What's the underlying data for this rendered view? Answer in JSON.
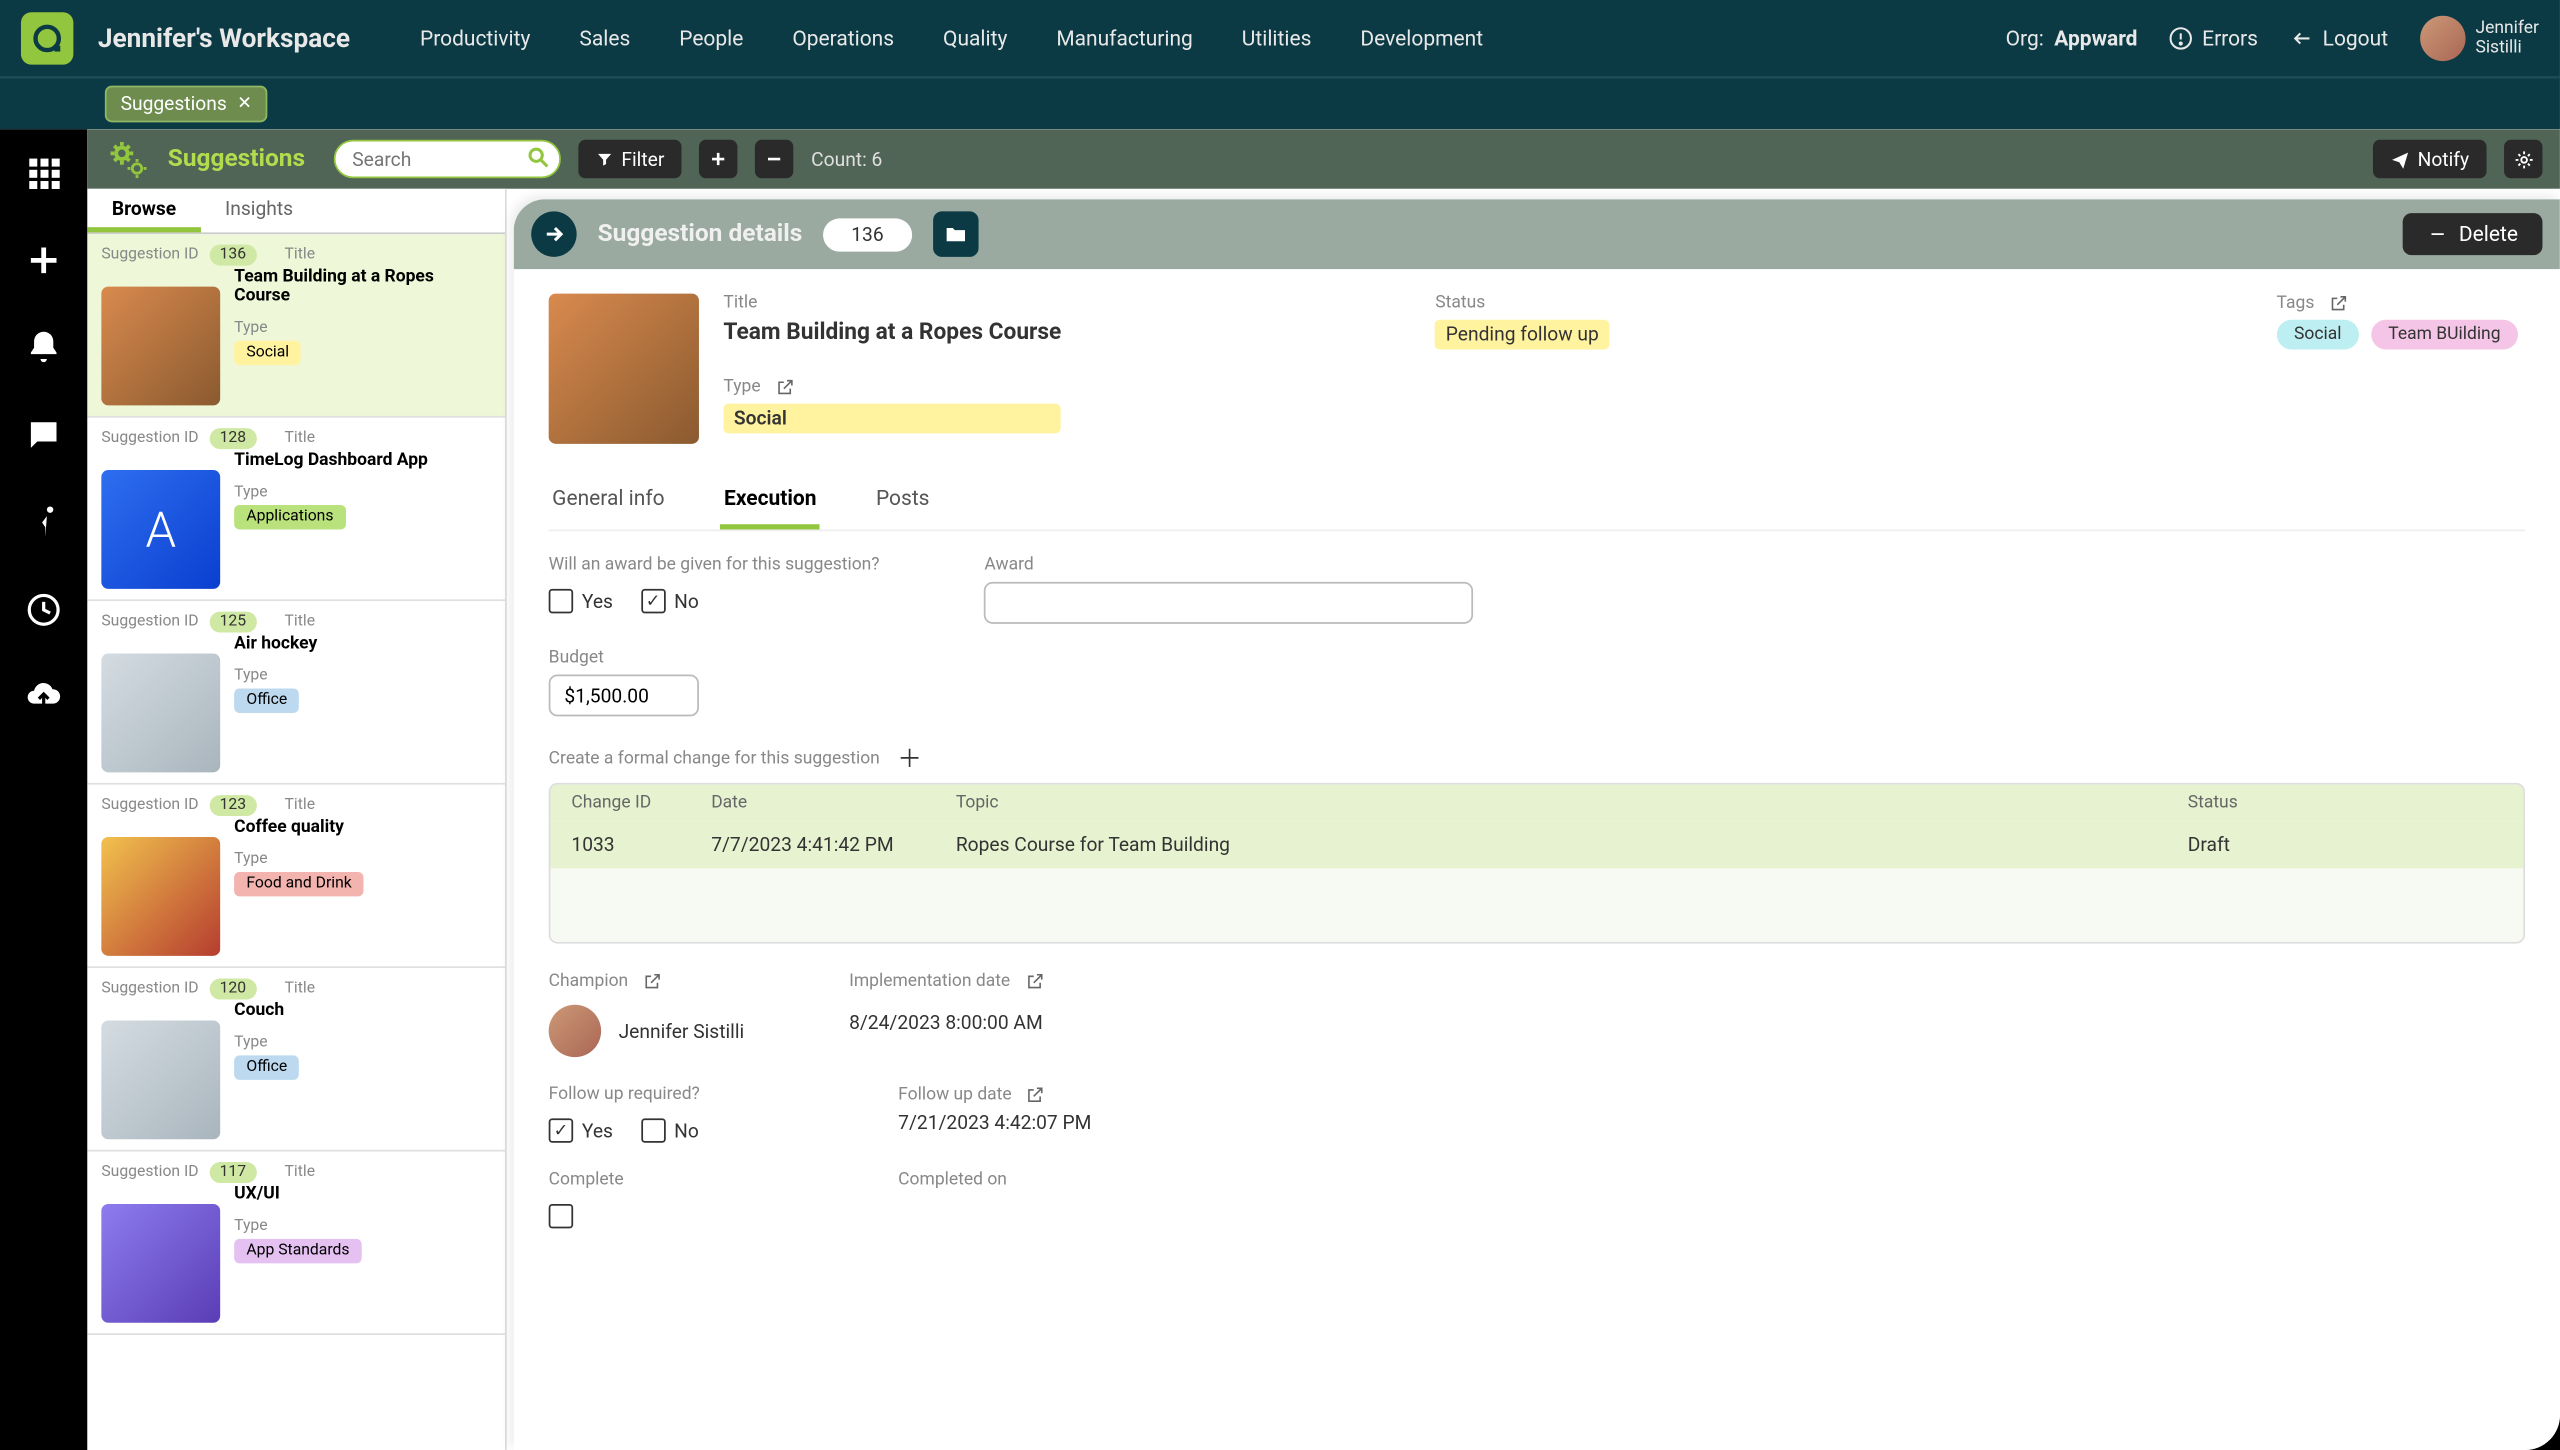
{
  "topbar": {
    "workspace": "Jennifer's Workspace",
    "nav": [
      "Productivity",
      "Sales",
      "People",
      "Operations",
      "Quality",
      "Manufacturing",
      "Utilities",
      "Development"
    ],
    "org_label": "Org:",
    "org_value": "Appward",
    "errors": "Errors",
    "logout": "Logout",
    "user_first": "Jennifer",
    "user_last": "Sistilli"
  },
  "chip": {
    "label": "Suggestions"
  },
  "toolbar": {
    "title": "Suggestions",
    "search_placeholder": "Search",
    "filter": "Filter",
    "count": "Count: 6",
    "notify": "Notify"
  },
  "list": {
    "tabs": {
      "browse": "Browse",
      "insights": "Insights"
    },
    "id_label": "Suggestion ID",
    "title_label": "Title",
    "type_label": "Type",
    "items": [
      {
        "id": "136",
        "title": "Team Building at a Ropes Course",
        "type": "Social",
        "type_color": "yellow",
        "thumb": "team",
        "selected": true
      },
      {
        "id": "128",
        "title": "TimeLog Dashboard App",
        "type": "Applications",
        "type_color": "green",
        "thumb": "app"
      },
      {
        "id": "125",
        "title": "Air hockey",
        "type": "Office",
        "type_color": "blue",
        "thumb": "office"
      },
      {
        "id": "123",
        "title": "Coffee quality",
        "type": "Food and Drink",
        "type_color": "red",
        "thumb": "food"
      },
      {
        "id": "120",
        "title": "Couch",
        "type": "Office",
        "type_color": "blue",
        "thumb": "office"
      },
      {
        "id": "117",
        "title": "UX/UI",
        "type": "App Standards",
        "type_color": "purple",
        "thumb": "ux"
      }
    ]
  },
  "detail": {
    "header": "Suggestion details",
    "id": "136",
    "delete": "Delete",
    "title_label": "Title",
    "title": "Team Building at a Ropes Course",
    "type_label": "Type",
    "type": "Social",
    "status_label": "Status",
    "status": "Pending follow up",
    "tags_label": "Tags",
    "tags": [
      "Social",
      "Team BUilding"
    ],
    "tabs": {
      "general": "General info",
      "execution": "Execution",
      "posts": "Posts"
    },
    "award_q": "Will an award be given for this suggestion?",
    "yes": "Yes",
    "no": "No",
    "award_label": "Award",
    "budget_label": "Budget",
    "budget_value": "$1,500.00",
    "change_label": "Create a formal change for this suggestion",
    "change_cols": {
      "id": "Change ID",
      "date": "Date",
      "topic": "Topic",
      "status": "Status"
    },
    "change_row": {
      "id": "1033",
      "date": "7/7/2023 4:41:42 PM",
      "topic": "Ropes Course for Team Building",
      "status": "Draft"
    },
    "champion_label": "Champion",
    "champion": "Jennifer Sistilli",
    "impl_label": "Implementation date",
    "impl_date": "8/24/2023 8:00:00 AM",
    "followup_q": "Follow up required?",
    "followup_date_label": "Follow up date",
    "followup_date": "7/21/2023 4:42:07 PM",
    "complete_label": "Complete",
    "completed_on_label": "Completed on"
  }
}
